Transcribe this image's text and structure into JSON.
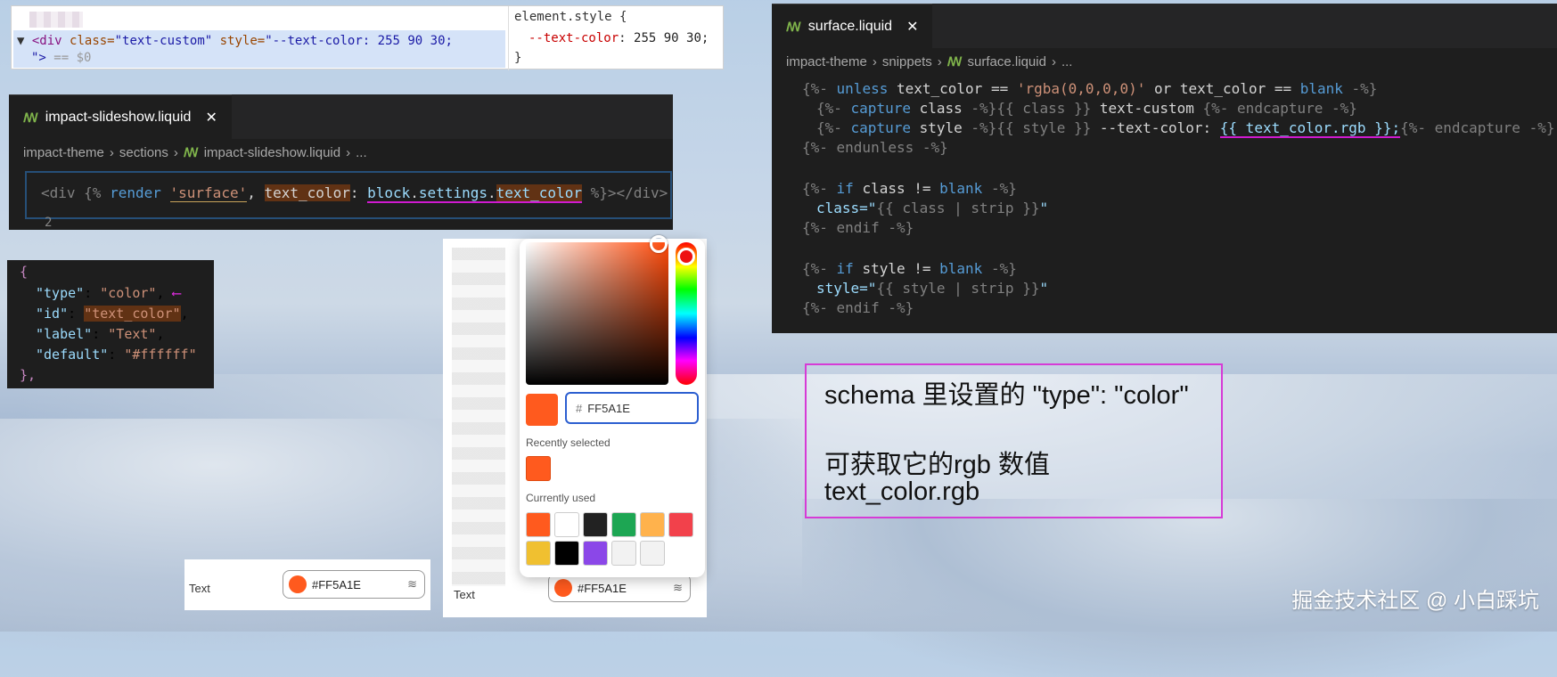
{
  "devtools": {
    "line1_tag": "<div",
    "line1_class_attr": "class=",
    "line1_class_val": "\"text-custom\"",
    "line1_style_attr": "style=",
    "line1_style_val": "\"--text-color: 255 90 30;",
    "line2": "\">",
    "line2_dim": "== $0",
    "style_rule": "element.style {",
    "style_prop": "--text-color",
    "style_value": ": 255 90 30;",
    "style_close": "}"
  },
  "slideshow_editor": {
    "tab": "impact-slideshow.liquid",
    "breadcrumb": [
      "impact-theme",
      "sections",
      "impact-slideshow.liquid",
      "..."
    ],
    "code": {
      "open": "<div",
      "tag_open": "{%",
      "render": "render",
      "surface": "'surface'",
      "comma": ",",
      "param": "text_color",
      "colon": ":",
      "block": "block",
      "dot1": ".",
      "settings": "settings",
      "dot2": ".",
      "field": "text_color",
      "tag_close": "%}",
      "gt": ">",
      "close_tag": "</div>"
    },
    "line_number": "2"
  },
  "surface_editor": {
    "tab": "surface.liquid",
    "breadcrumb": [
      "impact-theme",
      "snippets",
      "surface.liquid",
      "..."
    ],
    "lines": [
      [
        "{%-",
        " unless",
        " text_color == ",
        "'rgba(0,0,0,0)'",
        " or text_color == ",
        "blank",
        " -%}"
      ],
      [
        "{%-",
        " capture",
        " class ",
        "-%}",
        "{{ class }}",
        " text-custom ",
        "{%- endcapture -%}"
      ],
      [
        "{%-",
        " capture",
        " style ",
        "-%}",
        "{{ style }}",
        " --text-color: ",
        "{{ text_color.rgb }};",
        "{%- endcapture -%}"
      ],
      [
        "{%- endunless -%}"
      ],
      [],
      [
        "{%-",
        " if",
        " class != ",
        "blank",
        " -%}"
      ],
      [
        "class=\"",
        "{{ class | strip }}",
        "\""
      ],
      [
        "{%- endif -%}"
      ],
      [],
      [
        "{%-",
        " if",
        " style != ",
        "blank",
        " -%}"
      ],
      [
        "style=\"",
        "{{ style | strip }}",
        "\""
      ],
      [
        "{%- endif -%}"
      ]
    ]
  },
  "schema_json": {
    "open": "{",
    "type_key": "\"type\"",
    "type_val": "\"color\"",
    "id_key": "\"id\"",
    "id_val": "\"text_color\"",
    "label_key": "\"label\"",
    "label_val": "\"Text\"",
    "default_key": "\"default\"",
    "default_val": "\"#ffffff\"",
    "close": "},"
  },
  "color_picker": {
    "hash": "#",
    "hex_value": "FF5A1E",
    "recently_selected_label": "Recently selected",
    "currently_used_label": "Currently used",
    "selected_color": "#FF5A1E",
    "recent_colors": [
      "#FF5A1E"
    ],
    "used_colors": [
      "#FF5A1E",
      "#FFFFFF",
      "#222222",
      "#1DA653",
      "#FFB24C",
      "#F2414B",
      "#F0C030",
      "#000000",
      "#8B47E8",
      "#F2F2F2",
      "#F2F2F2"
    ],
    "field_label": "Text",
    "field_value": "#FF5A1E"
  },
  "field_left": {
    "label": "Text",
    "value": "#FF5A1E"
  },
  "note": {
    "line1": "schema 里设置的 \"type\": \"color\"",
    "line2": "可获取它的rgb 数值",
    "line3": "text_color.rgb"
  },
  "watermark": "掘金技术社区 @ 小白踩坑"
}
